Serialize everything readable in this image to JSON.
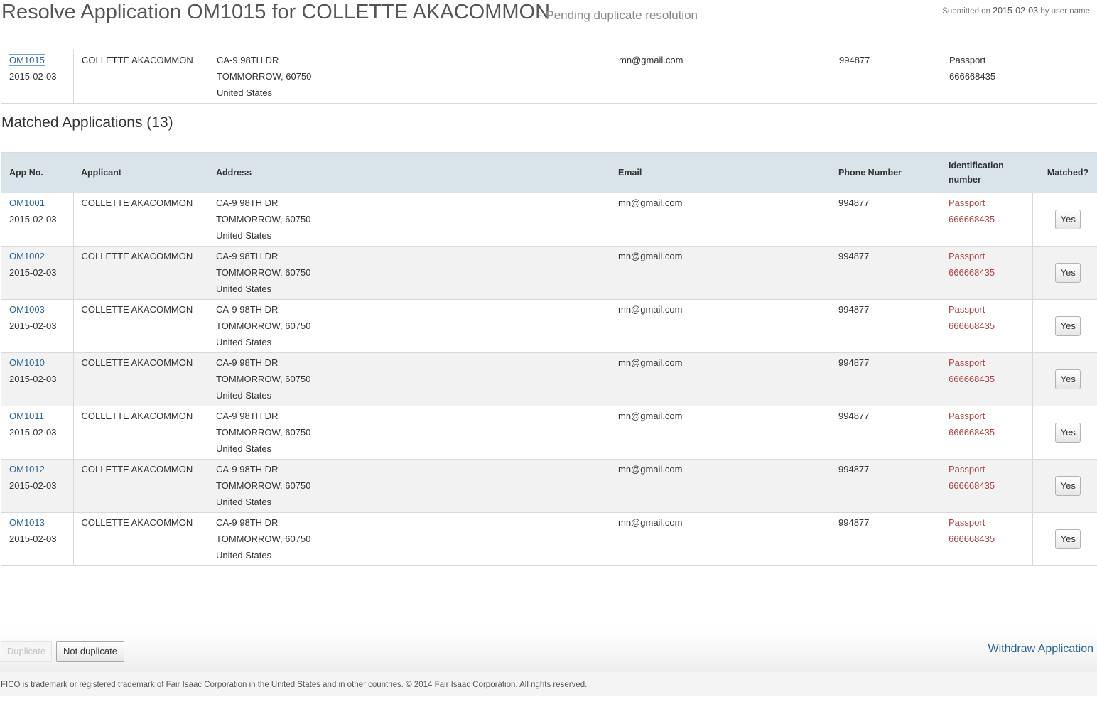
{
  "header": {
    "title": "Resolve Application OM1015 for COLLETTE AKACOMMON",
    "status": "- Pending duplicate resolution",
    "submitted_prefix": "Submitted on",
    "submitted_date": "2015-02-03",
    "submitted_suffix": "by user name"
  },
  "application": {
    "app_no": "OM1015",
    "date": "2015-02-03",
    "applicant": "COLLETTE AKACOMMON",
    "address_line1": "CA-9 98TH DR",
    "address_line2": "TOMMORROW, 60750",
    "address_line3": "United States",
    "email": "mn@gmail.com",
    "phone": "994877",
    "id_type": "Passport",
    "id_number": "666668435"
  },
  "matched": {
    "title": "Matched Applications (13)",
    "columns": {
      "app_no": "App No.",
      "applicant": "Applicant",
      "address": "Address",
      "email": "Email",
      "phone": "Phone Number",
      "id_line1": "Identification",
      "id_line2": "number",
      "matched": "Matched?"
    },
    "rows": [
      {
        "app_no": "OM1001",
        "date": "2015-02-03",
        "applicant": "COLLETTE AKACOMMON",
        "address_line1": "CA-9 98TH DR",
        "address_line2": "TOMMORROW, 60750",
        "address_line3": "United States",
        "email": "mn@gmail.com",
        "phone": "994877",
        "id_type": "Passport",
        "id_number": "666668435",
        "matched": "Yes"
      },
      {
        "app_no": "OM1002",
        "date": "2015-02-03",
        "applicant": "COLLETTE AKACOMMON",
        "address_line1": "CA-9 98TH DR",
        "address_line2": "TOMMORROW, 60750",
        "address_line3": "United States",
        "email": "mn@gmail.com",
        "phone": "994877",
        "id_type": "Passport",
        "id_number": "666668435",
        "matched": "Yes"
      },
      {
        "app_no": "OM1003",
        "date": "2015-02-03",
        "applicant": "COLLETTE AKACOMMON",
        "address_line1": "CA-9 98TH DR",
        "address_line2": "TOMMORROW, 60750",
        "address_line3": "United States",
        "email": "mn@gmail.com",
        "phone": "994877",
        "id_type": "Passport",
        "id_number": "666668435",
        "matched": "Yes"
      },
      {
        "app_no": "OM1010",
        "date": "2015-02-03",
        "applicant": "COLLETTE AKACOMMON",
        "address_line1": "CA-9 98TH DR",
        "address_line2": "TOMMORROW, 60750",
        "address_line3": "United States",
        "email": "mn@gmail.com",
        "phone": "994877",
        "id_type": "Passport",
        "id_number": "666668435",
        "matched": "Yes"
      },
      {
        "app_no": "OM1011",
        "date": "2015-02-03",
        "applicant": "COLLETTE AKACOMMON",
        "address_line1": "CA-9 98TH DR",
        "address_line2": "TOMMORROW, 60750",
        "address_line3": "United States",
        "email": "mn@gmail.com",
        "phone": "994877",
        "id_type": "Passport",
        "id_number": "666668435",
        "matched": "Yes"
      },
      {
        "app_no": "OM1012",
        "date": "2015-02-03",
        "applicant": "COLLETTE AKACOMMON",
        "address_line1": "CA-9 98TH DR",
        "address_line2": "TOMMORROW, 60750",
        "address_line3": "United States",
        "email": "mn@gmail.com",
        "phone": "994877",
        "id_type": "Passport",
        "id_number": "666668435",
        "matched": "Yes"
      },
      {
        "app_no": "OM1013",
        "date": "2015-02-03",
        "applicant": "COLLETTE AKACOMMON",
        "address_line1": "CA-9 98TH DR",
        "address_line2": "TOMMORROW, 60750",
        "address_line3": "United States",
        "email": "mn@gmail.com",
        "phone": "994877",
        "id_type": "Passport",
        "id_number": "666668435",
        "matched": "Yes"
      }
    ]
  },
  "actions": {
    "duplicate": "Duplicate",
    "not_duplicate": "Not duplicate",
    "withdraw": "Withdraw Application"
  },
  "footer": {
    "text": "FICO is trademark or registered trademark of Fair Isaac Corporation in the United States and in other countries. © 2014 Fair Isaac Corporation. All rights reserved."
  },
  "colors": {
    "link": "#2a6496",
    "id_red": "#a94442",
    "header_bg": "#d8e3ea"
  }
}
